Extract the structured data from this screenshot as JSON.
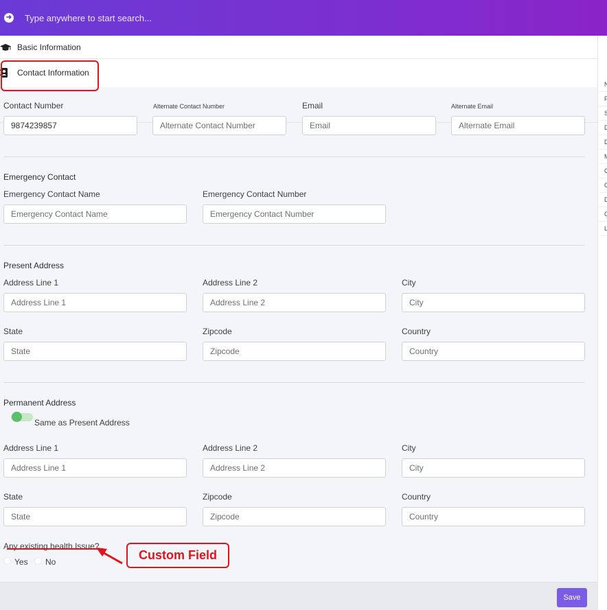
{
  "header": {
    "search_placeholder": "Type anywhere to start search..."
  },
  "tabs": {
    "basic": "Basic Information",
    "contact": "Contact Information"
  },
  "contact": {
    "number_label": "Contact Number",
    "number_value": "9874239857",
    "alt_number_label": "Alternate Contact Number",
    "alt_number_placeholder": "Alternate Contact Number",
    "email_label": "Email",
    "email_placeholder": "Email",
    "alt_email_label": "Alternate Email",
    "alt_email_placeholder": "Alternate Email"
  },
  "emergency": {
    "title": "Emergency Contact",
    "name_label": "Emergency Contact Name",
    "name_placeholder": "Emergency Contact Name",
    "number_label": "Emergency Contact Number",
    "number_placeholder": "Emergency Contact Number"
  },
  "present": {
    "title": "Present Address",
    "line1_label": "Address Line 1",
    "line1_placeholder": "Address Line 1",
    "line2_label": "Address Line 2",
    "line2_placeholder": "Address Line 2",
    "city_label": "City",
    "city_placeholder": "City",
    "state_label": "State",
    "state_placeholder": "State",
    "zip_label": "Zipcode",
    "zip_placeholder": "Zipcode",
    "country_label": "Country",
    "country_placeholder": "Country"
  },
  "permanent": {
    "title": "Permanent Address",
    "same_label": "Same as Present Address",
    "line1_label": "Address Line 1",
    "line1_placeholder": "Address Line 1",
    "line2_label": "Address Line 2",
    "line2_placeholder": "Address Line 2",
    "city_label": "City",
    "city_placeholder": "City",
    "state_label": "State",
    "state_placeholder": "State",
    "zip_label": "Zipcode",
    "zip_placeholder": "Zipcode",
    "country_label": "Country",
    "country_placeholder": "Country"
  },
  "health": {
    "question": "Any existing health Issue?",
    "yes": "Yes",
    "no": "No"
  },
  "annotation": {
    "text": "Custom Field",
    "color": "#e3131b"
  },
  "sidebar_letters": [
    "N",
    "F",
    "S",
    "D",
    "D",
    "M",
    "C",
    "C",
    "D",
    "C",
    "L"
  ],
  "footer": {
    "save_label": "Save"
  },
  "colors": {
    "header_start": "#6a3bd6",
    "header_end": "#8a24c8",
    "save_button": "#7b5ce6",
    "toggle": "#5dbf6a"
  }
}
